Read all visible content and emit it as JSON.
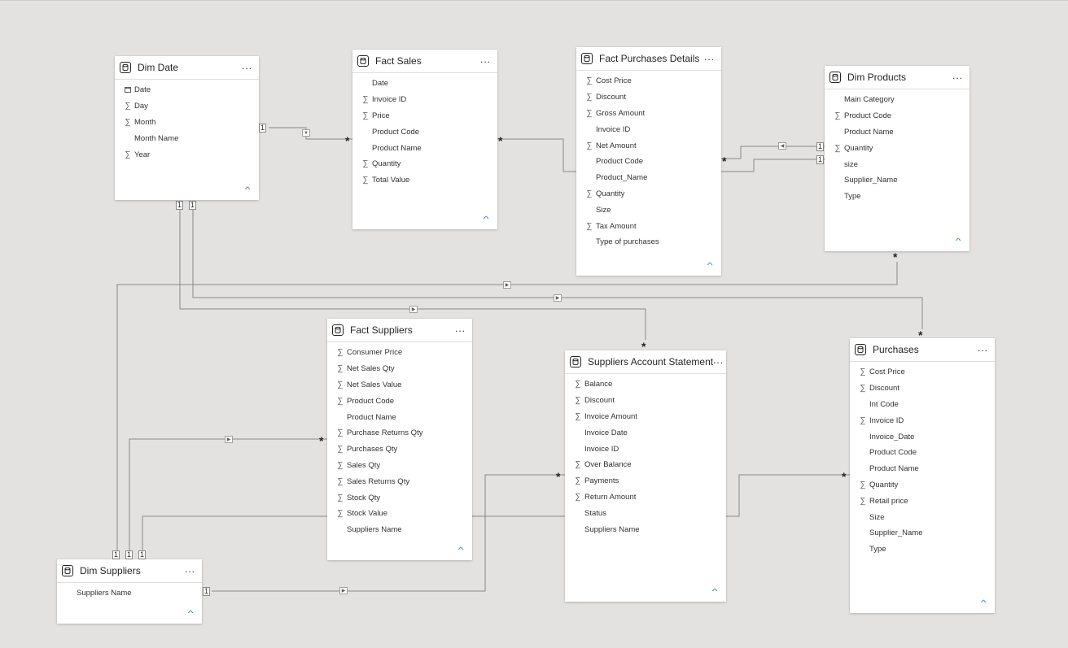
{
  "tables": {
    "dim_date": {
      "title": "Dim Date",
      "more": "...",
      "fields": [
        {
          "name": "Date",
          "icon": "calendar-icon"
        },
        {
          "name": "Day",
          "icon": "sigma-icon"
        },
        {
          "name": "Month",
          "icon": "sigma-icon"
        },
        {
          "name": "Month Name",
          "icon": ""
        },
        {
          "name": "Year",
          "icon": "sigma-icon"
        }
      ]
    },
    "fact_sales": {
      "title": "Fact Sales",
      "more": "...",
      "fields": [
        {
          "name": "Date",
          "icon": ""
        },
        {
          "name": "Invoice ID",
          "icon": "sigma-icon"
        },
        {
          "name": "Price",
          "icon": "sigma-icon"
        },
        {
          "name": "Product Code",
          "icon": ""
        },
        {
          "name": "Product Name",
          "icon": ""
        },
        {
          "name": "Quantity",
          "icon": "sigma-icon"
        },
        {
          "name": "Total Value",
          "icon": "sigma-icon"
        }
      ]
    },
    "fact_purchases_details": {
      "title": "Fact Purchases Details",
      "more": "...",
      "fields": [
        {
          "name": "Cost Price",
          "icon": "sigma-icon"
        },
        {
          "name": "Discount",
          "icon": "sigma-icon"
        },
        {
          "name": "Gross Amount",
          "icon": "sigma-icon"
        },
        {
          "name": "Invoice ID",
          "icon": ""
        },
        {
          "name": "Net Amount",
          "icon": "sigma-icon"
        },
        {
          "name": "Product Code",
          "icon": ""
        },
        {
          "name": "Product_Name",
          "icon": ""
        },
        {
          "name": "Quantity",
          "icon": "sigma-icon"
        },
        {
          "name": "Size",
          "icon": ""
        },
        {
          "name": "Tax Amount",
          "icon": "sigma-icon"
        },
        {
          "name": "Type of purchases",
          "icon": ""
        }
      ]
    },
    "dim_products": {
      "title": "Dim Products",
      "more": "...",
      "fields": [
        {
          "name": "Main Category",
          "icon": ""
        },
        {
          "name": "Product Code",
          "icon": "sigma-icon"
        },
        {
          "name": "Product Name",
          "icon": ""
        },
        {
          "name": "Quantity",
          "icon": "sigma-icon"
        },
        {
          "name": "size",
          "icon": ""
        },
        {
          "name": "Supplier_Name",
          "icon": ""
        },
        {
          "name": "Type",
          "icon": ""
        }
      ]
    },
    "fact_suppliers": {
      "title": "Fact Suppliers",
      "more": "...",
      "fields": [
        {
          "name": "Consumer Price",
          "icon": "sigma-icon"
        },
        {
          "name": "Net Sales Qty",
          "icon": "sigma-icon"
        },
        {
          "name": "Net Sales Value",
          "icon": "sigma-icon"
        },
        {
          "name": "Product Code",
          "icon": "sigma-icon"
        },
        {
          "name": "Product Name",
          "icon": ""
        },
        {
          "name": "Purchase Returns Qty",
          "icon": "sigma-icon"
        },
        {
          "name": "Purchases Qty",
          "icon": "sigma-icon"
        },
        {
          "name": "Sales Qty",
          "icon": "sigma-icon"
        },
        {
          "name": "Sales Returns Qty",
          "icon": "sigma-icon"
        },
        {
          "name": "Stock Qty",
          "icon": "sigma-icon"
        },
        {
          "name": "Stock Value",
          "icon": "sigma-icon"
        },
        {
          "name": "Suppliers Name",
          "icon": ""
        }
      ]
    },
    "suppliers_account_statement": {
      "title": "Suppliers Account Statement",
      "more": "...",
      "fields": [
        {
          "name": "Balance",
          "icon": "sigma-icon"
        },
        {
          "name": "Discount",
          "icon": "sigma-icon"
        },
        {
          "name": "Invoice Amount",
          "icon": "sigma-icon"
        },
        {
          "name": "Invoice Date",
          "icon": ""
        },
        {
          "name": "Invoice ID",
          "icon": ""
        },
        {
          "name": "Over Balance",
          "icon": "sigma-icon"
        },
        {
          "name": "Payments",
          "icon": "sigma-icon"
        },
        {
          "name": "Return Amount",
          "icon": "sigma-icon"
        },
        {
          "name": "Status",
          "icon": ""
        },
        {
          "name": "Suppliers Name",
          "icon": ""
        }
      ]
    },
    "purchases": {
      "title": "Purchases",
      "more": "...",
      "fields": [
        {
          "name": "Cost Price",
          "icon": "sigma-icon"
        },
        {
          "name": "Discount",
          "icon": "sigma-icon"
        },
        {
          "name": "Int Code",
          "icon": ""
        },
        {
          "name": "Invoice ID",
          "icon": "sigma-icon"
        },
        {
          "name": "Invoice_Date",
          "icon": ""
        },
        {
          "name": "Product Code",
          "icon": ""
        },
        {
          "name": "Product Name",
          "icon": ""
        },
        {
          "name": "Quantity",
          "icon": "sigma-icon"
        },
        {
          "name": "Retail price",
          "icon": "sigma-icon"
        },
        {
          "name": "Size",
          "icon": ""
        },
        {
          "name": "Supplier_Name",
          "icon": ""
        },
        {
          "name": "Type",
          "icon": ""
        }
      ]
    },
    "dim_suppliers": {
      "title": "Dim Suppliers",
      "more": "...",
      "fields": [
        {
          "name": "Suppliers Name",
          "icon": ""
        }
      ]
    }
  },
  "cardinality": {
    "one": "1",
    "many": "*"
  },
  "colors": {
    "canvas": "#e4e2e0",
    "wire": "#8a8886",
    "card": "#ffffff",
    "accent": "#2b88a8"
  }
}
